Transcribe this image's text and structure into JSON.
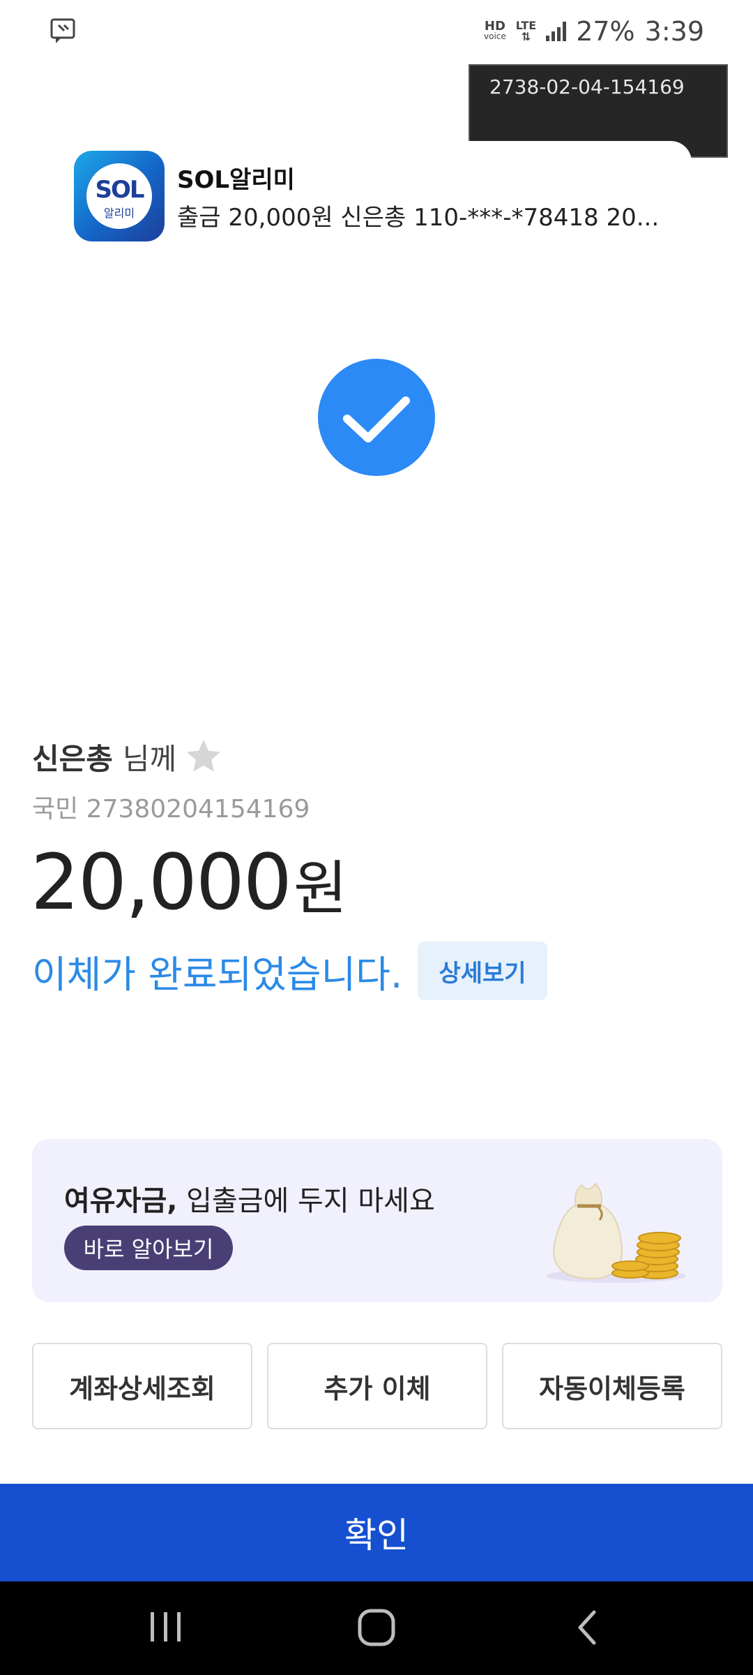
{
  "status_bar": {
    "hd_label": "HD",
    "voice_label": "voice",
    "network_label": "LTE",
    "battery": "27%",
    "time": "3:39",
    "left_icon": "screenshot-icon"
  },
  "overlay": {
    "text": "2738-02-04-154169"
  },
  "notification": {
    "app_icon_text": "SOL",
    "app_icon_subtext": "알리미",
    "title": "SOL알리미",
    "body": "출금 20,000원 신은총 110-***-*78418  20..."
  },
  "result": {
    "icon": "check-icon",
    "recipient_name": "신은총",
    "recipient_suffix": "님께",
    "favorite_icon": "star-icon",
    "account": "국민 27380204154169",
    "amount": "20,000",
    "currency": "원",
    "message": "이체가 완료되었습니다.",
    "detail_button": "상세보기"
  },
  "banner": {
    "title_bold": "여유자금,",
    "title_rest": " 입출금에 두지 마세요",
    "button": "바로 알아보기",
    "illustration": "money-bag-coins"
  },
  "actions": [
    {
      "label": "계좌상세조회"
    },
    {
      "label": "추가 이체"
    },
    {
      "label": "자동이체등록"
    }
  ],
  "confirm_button": "확인",
  "colors": {
    "accent_blue": "#2b8af5",
    "confirm_blue": "#1650d0",
    "banner_bg": "#f1f0fd",
    "banner_button": "#4a3f75"
  },
  "navbar": {
    "recent_icon": "recent-apps-icon",
    "home_icon": "home-icon",
    "back_icon": "back-icon"
  }
}
